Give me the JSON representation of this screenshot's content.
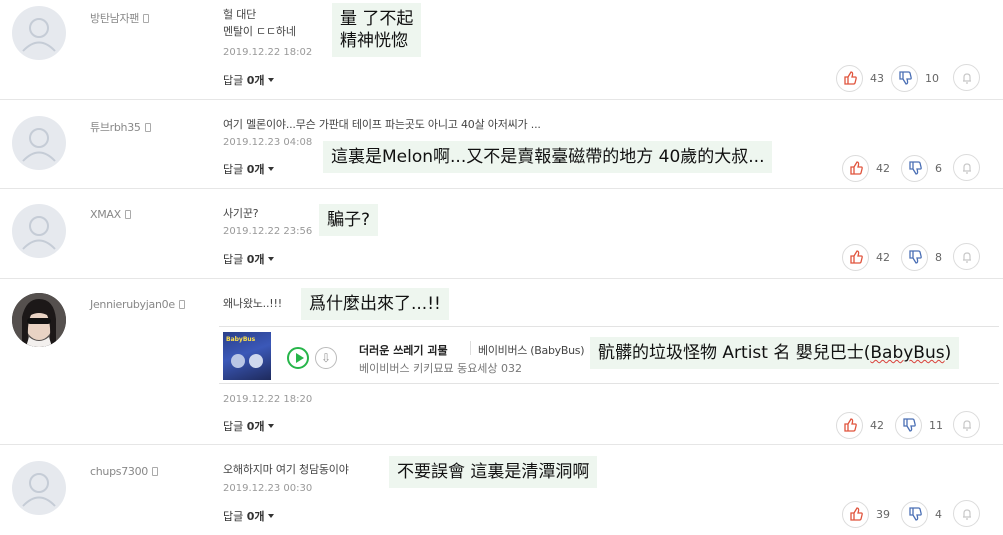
{
  "labels": {
    "reply": "답글",
    "reply_suffix": "개"
  },
  "comments": [
    {
      "username": "방탄남자팬",
      "text_lines": [
        "헐 대단",
        "멘탈이 ㄷㄷ하네"
      ],
      "date": "2019.12.22  18:02",
      "replies": "0",
      "likes": "43",
      "dislikes": "10",
      "translation": [
        "量 了不起",
        "精神恍惚"
      ]
    },
    {
      "username": "튜브rbh35",
      "text_lines": [
        "여기 멜론이야...무슨 가판대 테이프 파는곳도 아니고 40살 아저씨가 ..."
      ],
      "date": "2019.12.23  04:08",
      "replies": "0",
      "likes": "42",
      "dislikes": "6",
      "translation": [
        "這裏是Melon啊...又不是賣報臺磁帶的地方 40歲的大叔..."
      ]
    },
    {
      "username": "XMAX",
      "text_lines": [
        "사기꾼?"
      ],
      "date": "2019.12.22  23:56",
      "replies": "0",
      "likes": "42",
      "dislikes": "8",
      "translation": [
        "騙子?"
      ]
    },
    {
      "username": "Jennierubyjan0e",
      "text_lines": [
        "왜나왔노..!!!"
      ],
      "date": "2019.12.22  18:20",
      "replies": "0",
      "likes": "42",
      "dislikes": "11",
      "translation": [
        "爲什麼出來了...!!"
      ],
      "music": {
        "song": "더러운 쓰레기 괴물",
        "artist": "베이비버스 (BabyBus)",
        "album": "베이비버스 키키묘묘 동요세상 032",
        "album_art_text": "BabyBus",
        "translation_prefix": "骯髒的垃圾怪物 Artist 名 嬰兒巴士(",
        "translation_squiggle": "BabyBus",
        "translation_suffix": ")"
      }
    },
    {
      "username": "chups7300",
      "text_lines": [
        "오해하지마 여기 청담동이야"
      ],
      "date": "2019.12.23  00:30",
      "replies": "0",
      "likes": "39",
      "dislikes": "4",
      "translation": [
        "不要誤會 這裏是清潭洞啊"
      ]
    }
  ]
}
